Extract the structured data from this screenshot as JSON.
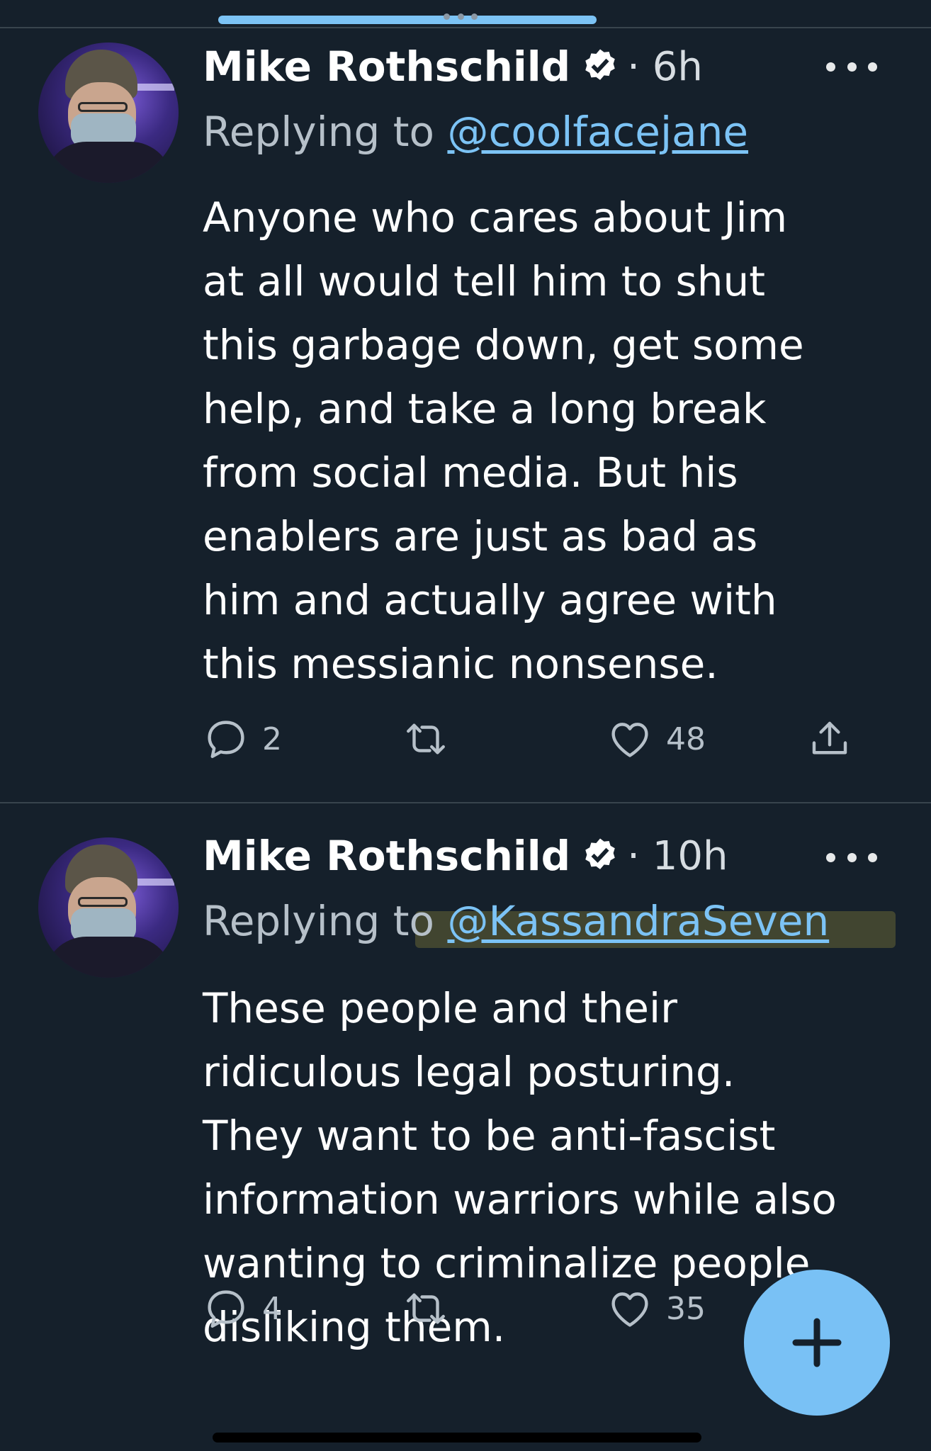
{
  "tweets": [
    {
      "author": "Mike Rothschild",
      "time": "· 6h",
      "replying_prefix": "Replying to",
      "replying_handle": "@coolfacejane",
      "body_lines": [
        "Anyone who cares about Jim",
        "at all would tell him to shut",
        "this garbage down, get some",
        "help, and take a long break",
        "from social media. But his",
        "enablers are just as bad as",
        "him and actually agree with",
        "this messianic nonsense."
      ],
      "replies": "2",
      "likes": "48"
    },
    {
      "author": "Mike Rothschild",
      "time": "· 10h",
      "replying_prefix": "Replying to",
      "replying_handle": "@KassandraSeven",
      "body_lines": [
        "These people and their",
        "ridiculous legal posturing.",
        "They want to be anti-fascist",
        "information warriors while also",
        "wanting to criminalize people",
        "disliking them."
      ],
      "replies": "4",
      "likes": "35"
    }
  ],
  "icons": {
    "verified": "verified-badge-icon",
    "more": "more-icon",
    "reply": "reply-icon",
    "retweet": "retweet-icon",
    "like": "heart-icon",
    "share": "share-icon",
    "compose": "plus-icon"
  },
  "colors": {
    "background": "#15202b",
    "accent": "#7cc3f5",
    "secondary_text": "#b6c0c9",
    "fab": "#79c1f5"
  }
}
